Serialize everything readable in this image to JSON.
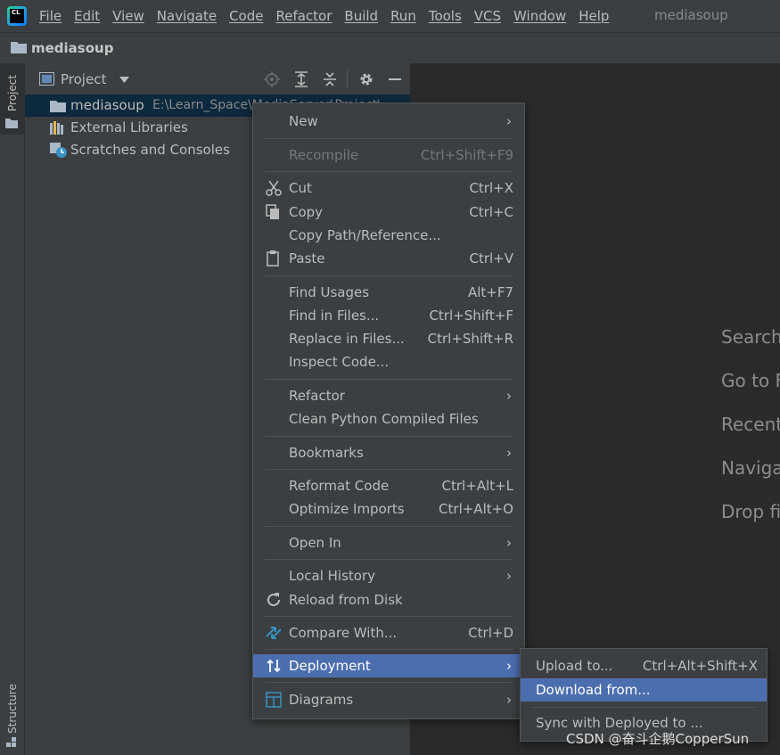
{
  "menubar": {
    "logo_text": "CL",
    "items": [
      "File",
      "Edit",
      "View",
      "Navigate",
      "Code",
      "Refactor",
      "Build",
      "Run",
      "Tools",
      "VCS",
      "Window",
      "Help"
    ],
    "project_title": "mediasoup"
  },
  "navbar": {
    "project_name": "mediasoup"
  },
  "left_strip": {
    "project_tab": "Project",
    "structure_tab": "Structure"
  },
  "project_panel": {
    "view_selector": "Project",
    "tree": [
      {
        "label": "mediasoup",
        "path": "E:\\Learn_Space\\MediaServer\\Project\\..."
      },
      {
        "label": "External Libraries",
        "path": ""
      },
      {
        "label": "Scratches and Consoles",
        "path": ""
      }
    ]
  },
  "editor_hints": [
    "Search",
    "Go to F",
    "Recent",
    "Naviga",
    "Drop fi"
  ],
  "context_menu": {
    "new": "New",
    "recompile": "Recompile",
    "recompile_sc": "Ctrl+Shift+F9",
    "cut": "Cut",
    "cut_sc": "Ctrl+X",
    "copy": "Copy",
    "copy_sc": "Ctrl+C",
    "copy_path": "Copy Path/Reference...",
    "paste": "Paste",
    "paste_sc": "Ctrl+V",
    "find_usages": "Find Usages",
    "find_usages_sc": "Alt+F7",
    "find_in_files": "Find in Files...",
    "find_in_files_sc": "Ctrl+Shift+F",
    "replace_in_files": "Replace in Files...",
    "replace_in_files_sc": "Ctrl+Shift+R",
    "inspect_code": "Inspect Code...",
    "refactor": "Refactor",
    "clean_python": "Clean Python Compiled Files",
    "bookmarks": "Bookmarks",
    "reformat_code": "Reformat Code",
    "reformat_code_sc": "Ctrl+Alt+L",
    "optimize_imports": "Optimize Imports",
    "optimize_imports_sc": "Ctrl+Alt+O",
    "open_in": "Open In",
    "local_history": "Local History",
    "reload_from_disk": "Reload from Disk",
    "compare_with": "Compare With...",
    "compare_with_sc": "Ctrl+D",
    "deployment": "Deployment",
    "diagrams": "Diagrams"
  },
  "deployment_submenu": {
    "upload_to": "Upload to...",
    "upload_to_sc": "Ctrl+Alt+Shift+X",
    "download_from": "Download from...",
    "sync_with_deployed": "Sync with Deployed to ..."
  },
  "watermark": "CSDN @奋斗企鹅CopperSun"
}
